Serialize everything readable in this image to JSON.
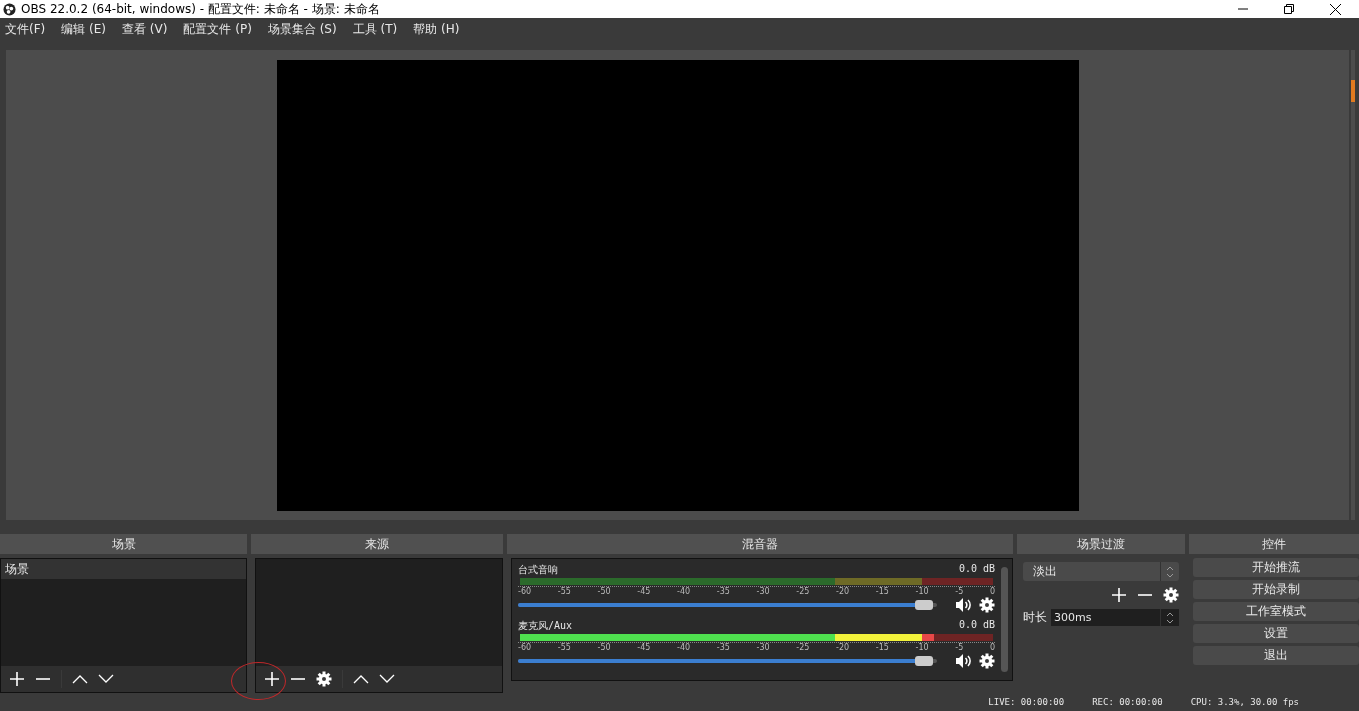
{
  "window": {
    "title": "OBS 22.0.2 (64-bit, windows) - 配置文件: 未命名 - 场景: 未命名"
  },
  "menu": [
    "文件(F)",
    "编辑 (E)",
    "查看 (V)",
    "配置文件 (P)",
    "场景集合 (S)",
    "工具 (T)",
    "帮助 (H)"
  ],
  "scenes": {
    "title": "场景",
    "items": [
      {
        "label": "场景",
        "selected": true
      }
    ]
  },
  "sources": {
    "title": "来源"
  },
  "mixer": {
    "title": "混音器",
    "channels": [
      {
        "name": "台式音响",
        "reading": "0.0 dB",
        "ticks": [
          "-60",
          "-55",
          "-50",
          "-45",
          "-40",
          "-35",
          "-30",
          "-25",
          "-20",
          "-15",
          "-10",
          "-5",
          "0"
        ],
        "volume": {
          "level": 0.97
        },
        "muted": false
      },
      {
        "name": "麦克风/Aux",
        "reading": "0.0 dB",
        "meter": {
          "level": 0.875
        },
        "ticks": [
          "-60",
          "-55",
          "-50",
          "-45",
          "-40",
          "-35",
          "-30",
          "-25",
          "-20",
          "-15",
          "-10",
          "-5",
          "0"
        ],
        "volume": {
          "level": 0.97
        },
        "muted": false
      }
    ]
  },
  "transitions": {
    "title": "场景过渡",
    "selected": "淡出",
    "duration_label": "时长",
    "duration": "300ms"
  },
  "controls": {
    "title": "控件",
    "buttons": [
      "开始推流",
      "开始录制",
      "工作室模式",
      "设置",
      "退出"
    ]
  },
  "status_bar": [
    "LIVE: 00:00:00",
    "REC: 00:00:00",
    "CPU: 3.3%, 30.00 fps"
  ]
}
